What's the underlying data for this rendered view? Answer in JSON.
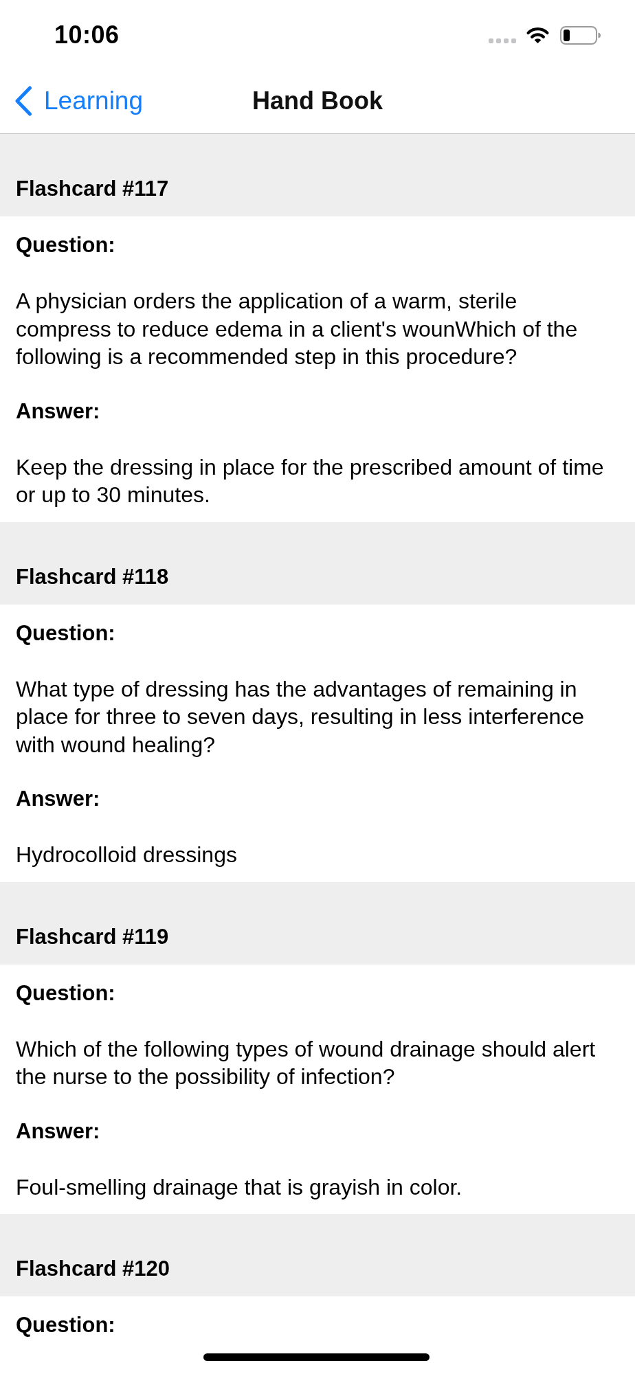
{
  "status_bar": {
    "time": "10:06"
  },
  "nav_bar": {
    "back_label": "Learning",
    "title": "Hand Book"
  },
  "flashcards": [
    {
      "title": "Flashcard #117",
      "question_label": "Question:",
      "question": "A physician orders the application of a warm, sterile compress to reduce edema in a client's wounWhich of the following is a recommended step in this procedure?",
      "answer_label": "Answer:",
      "answer": "Keep the dressing in place for the prescribed amount of time or up to 30 minutes."
    },
    {
      "title": "Flashcard #118",
      "question_label": "Question:",
      "question": "What type of dressing has the advantages of remaining in place for three to seven days, resulting in less interference with wound healing?",
      "answer_label": "Answer:",
      "answer": "Hydrocolloid dressings"
    },
    {
      "title": "Flashcard #119",
      "question_label": "Question:",
      "question": "Which of the following types of wound drainage should alert the nurse to the possibility of infection?",
      "answer_label": "Answer:",
      "answer": "Foul-smelling drainage that is grayish in color."
    },
    {
      "title": "Flashcard #120",
      "question_label": "Question:"
    }
  ]
}
